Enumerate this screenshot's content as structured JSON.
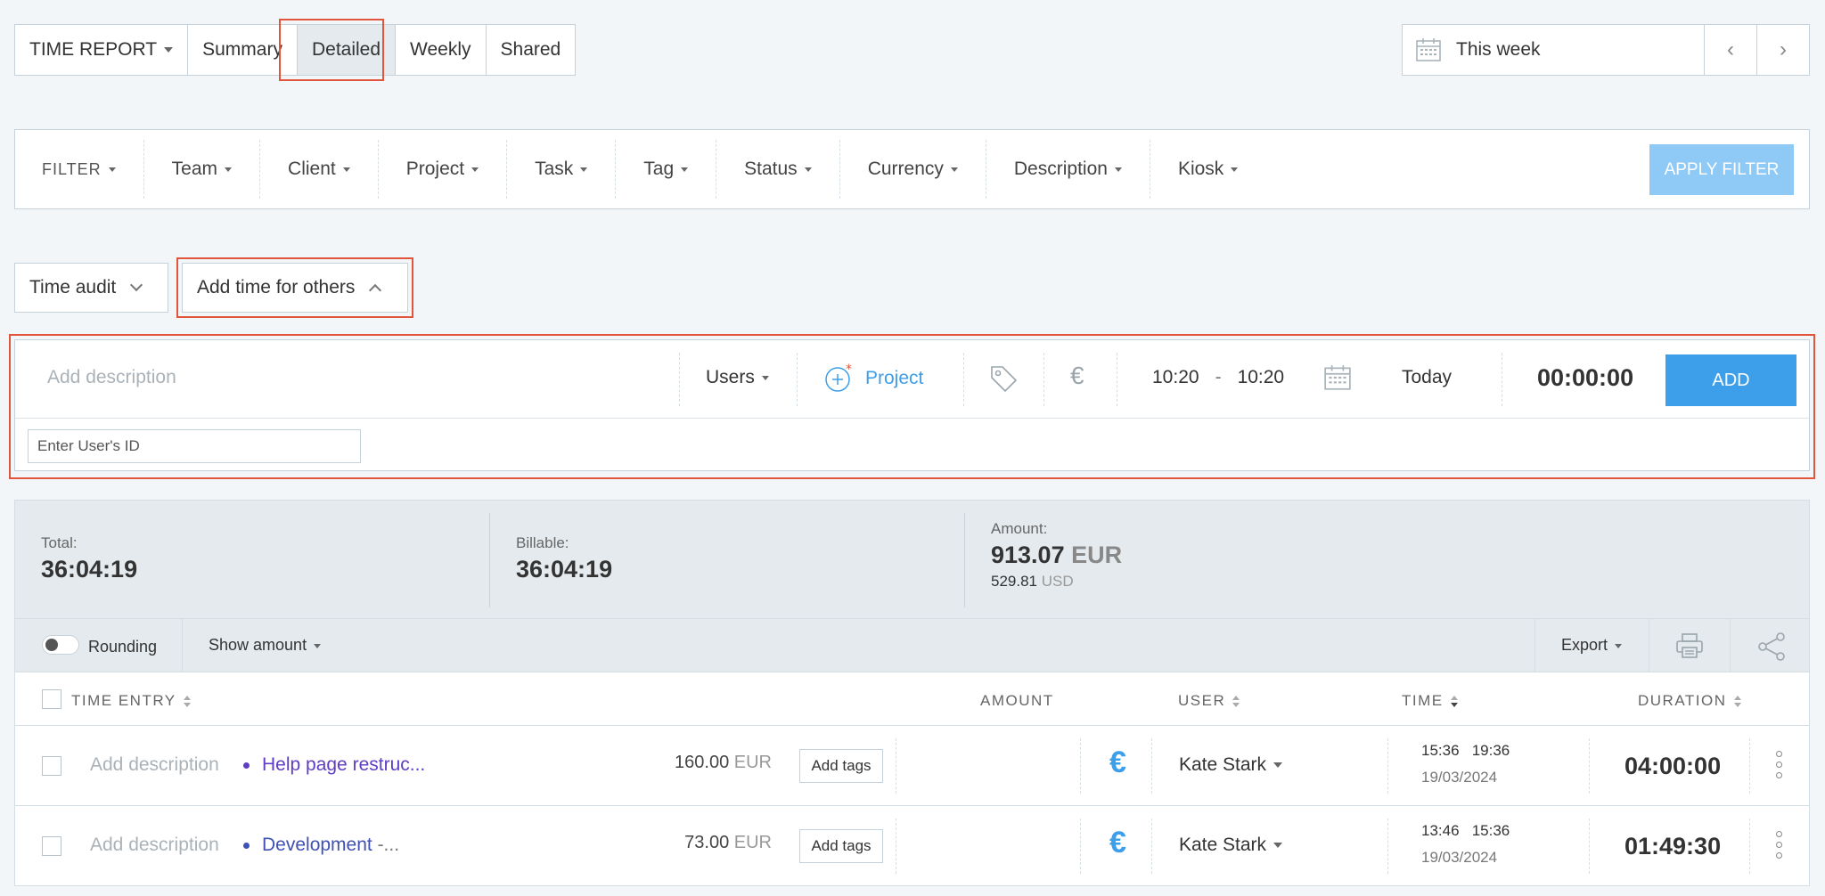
{
  "tabs": {
    "report_label": "TIME REPORT",
    "summary": "Summary",
    "detailed": "Detailed",
    "weekly": "Weekly",
    "shared": "Shared"
  },
  "date_range": {
    "label": "This week",
    "prev": "‹",
    "next": "›"
  },
  "filters": {
    "filter_label": "FILTER",
    "items": [
      "Team",
      "Client",
      "Project",
      "Task",
      "Tag",
      "Status",
      "Currency",
      "Description",
      "Kiosk"
    ],
    "apply_label": "APPLY FILTER"
  },
  "time_audit_label": "Time audit",
  "add_time_others_label": "Add time for others",
  "add_entry": {
    "description_placeholder": "Add description",
    "users_label": "Users",
    "project_label": "Project",
    "currency_symbol": "€",
    "start_time": "10:20",
    "time_sep": "-",
    "end_time": "10:20",
    "date_label": "Today",
    "duration": "00:00:00",
    "add_label": "ADD",
    "user_id_placeholder": "Enter User's ID"
  },
  "summary": {
    "total_label": "Total:",
    "total_value": "36:04:19",
    "billable_label": "Billable:",
    "billable_value": "36:04:19",
    "amount_label": "Amount:",
    "amount_value": "913.07",
    "amount_currency": "EUR",
    "amount_sub_value": "529.81",
    "amount_sub_currency": "USD"
  },
  "toolbar": {
    "rounding_label": "Rounding",
    "show_amount_label": "Show amount",
    "export_label": "Export"
  },
  "table": {
    "headers": {
      "time_entry": "TIME ENTRY",
      "amount": "AMOUNT",
      "user": "USER",
      "time": "TIME",
      "duration": "DURATION"
    },
    "rows": [
      {
        "description": "Add description",
        "project": "Help page restruc...",
        "project_suffix": "",
        "project_color": "#5f3dc4",
        "tags_label": "Add tags",
        "amount": "160.00",
        "currency": "EUR",
        "currency_symbol": "€",
        "user": "Kate Stark",
        "start": "15:36",
        "end": "19:36",
        "date": "19/03/2024",
        "duration": "04:00:00"
      },
      {
        "description": "Add description",
        "project": "Development",
        "project_suffix": " -...",
        "project_color": "#3f51b5",
        "tags_label": "Add tags",
        "amount": "73.00",
        "currency": "EUR",
        "currency_symbol": "€",
        "user": "Kate Stark",
        "start": "13:46",
        "end": "15:36",
        "date": "19/03/2024",
        "duration": "01:49:30"
      }
    ]
  },
  "colors": {
    "accent": "#3d9ee9",
    "apply_disabled": "#8fcaf7",
    "highlight": "#e2553d"
  }
}
